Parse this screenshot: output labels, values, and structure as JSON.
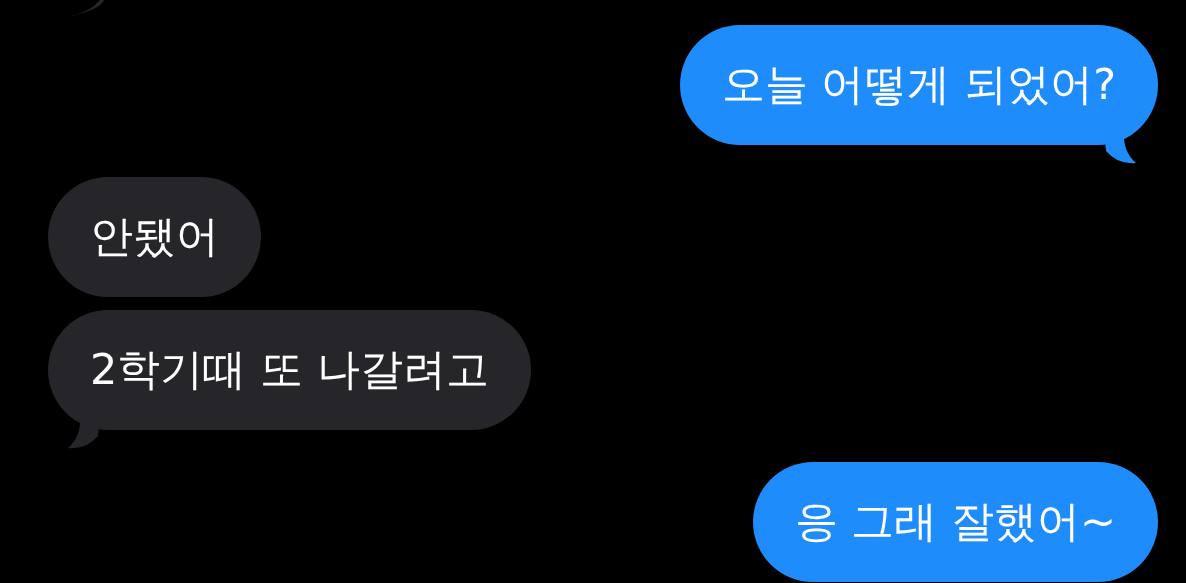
{
  "messages": [
    {
      "outgoing": true,
      "text": "오늘 어떻게 되었어?",
      "tail": true
    },
    {
      "outgoing": false,
      "text": "안됐어",
      "tail": false
    },
    {
      "outgoing": false,
      "text": "2학기때 또 나갈려고",
      "tail": true
    },
    {
      "outgoing": true,
      "text": "응 그래 잘했어~",
      "tail": false
    }
  ]
}
